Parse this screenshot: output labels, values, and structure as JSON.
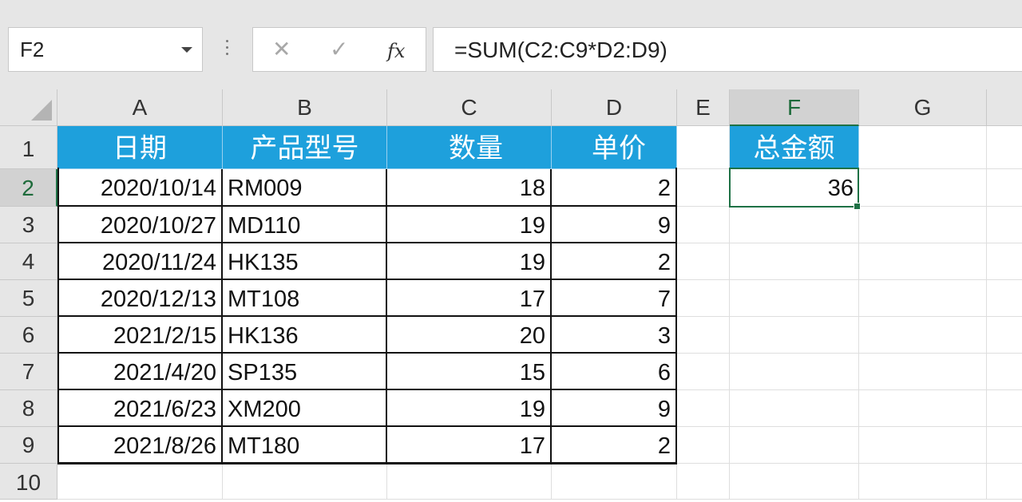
{
  "name_box": {
    "value": "F2"
  },
  "formula_bar": {
    "cancel_glyph": "✕",
    "enter_glyph": "✓",
    "fx_label": "fx",
    "formula": "=SUM(C2:C9*D2:D9)"
  },
  "columns": [
    "A",
    "B",
    "C",
    "D",
    "E",
    "F",
    "G"
  ],
  "rows": [
    "1",
    "2",
    "3",
    "4",
    "5",
    "6",
    "7",
    "8",
    "9",
    "10"
  ],
  "selected": {
    "column": "F",
    "row": "2"
  },
  "table": {
    "headers": [
      "日期",
      "产品型号",
      "数量",
      "单价"
    ],
    "rows": [
      [
        "2020/10/14",
        "RM009",
        "18",
        "2"
      ],
      [
        "2020/10/27",
        "MD110",
        "19",
        "9"
      ],
      [
        "2020/11/24",
        "HK135",
        "19",
        "2"
      ],
      [
        "2020/12/13",
        "MT108",
        "17",
        "7"
      ],
      [
        "2021/2/15",
        "HK136",
        "20",
        "3"
      ],
      [
        "2021/4/20",
        "SP135",
        "15",
        "6"
      ],
      [
        "2021/6/23",
        "XM200",
        "19",
        "9"
      ],
      [
        "2021/8/26",
        "MT180",
        "17",
        "2"
      ]
    ]
  },
  "summary": {
    "header": "总金额",
    "value": "36"
  },
  "colors": {
    "header_fill": "#1ea0dc",
    "selection": "#1e7145"
  }
}
